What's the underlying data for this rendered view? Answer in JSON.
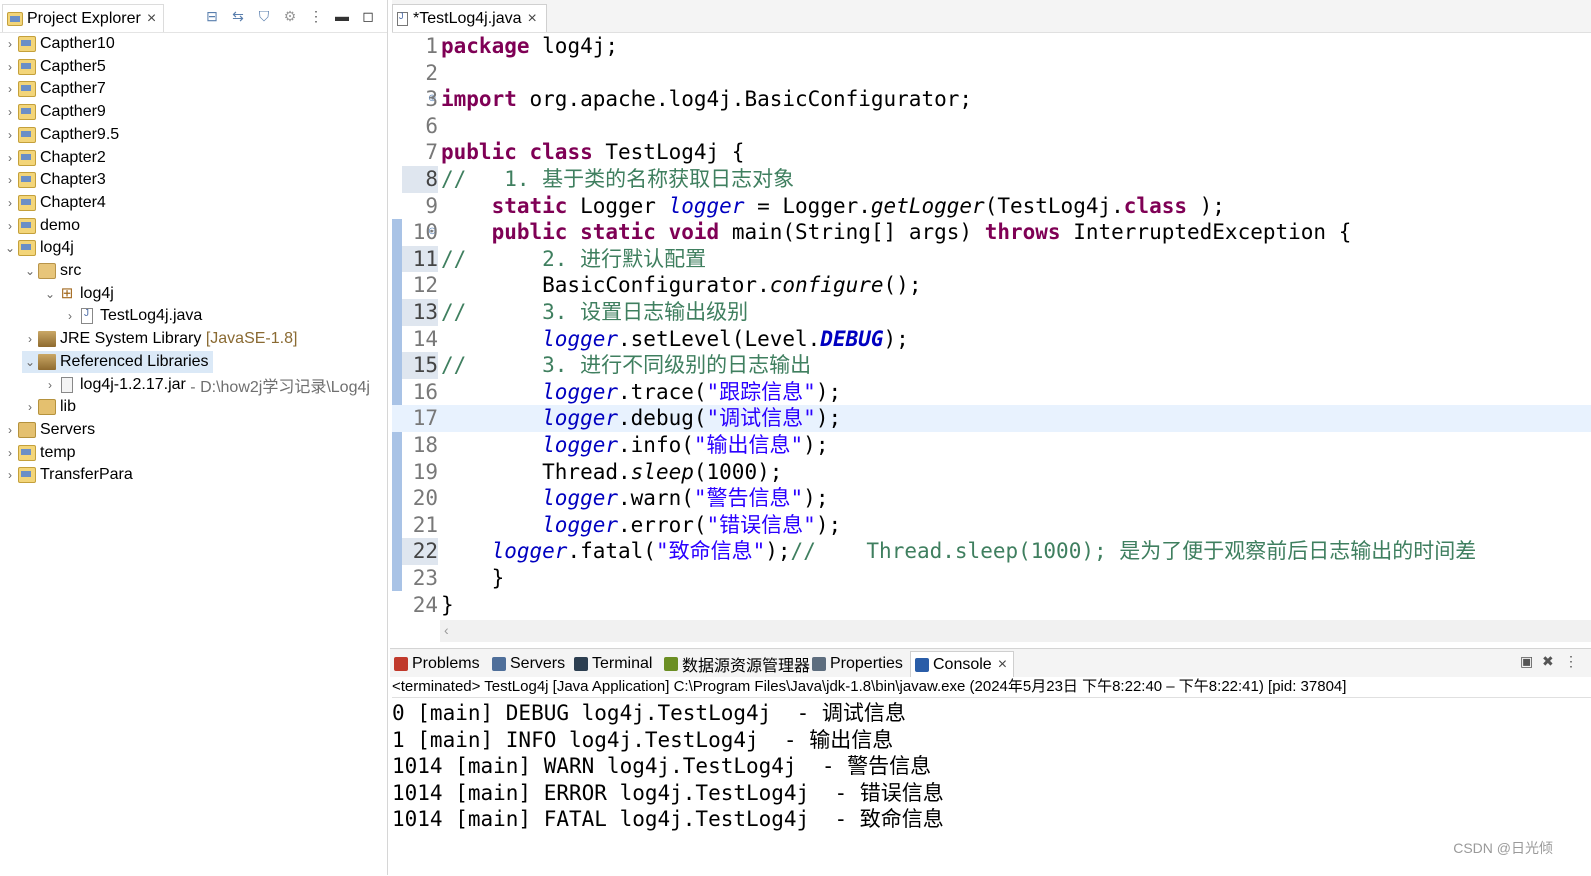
{
  "explorer": {
    "title": "Project Explorer",
    "tree": [
      {
        "label": "Capther10"
      },
      {
        "label": "Capther5"
      },
      {
        "label": "Capther7"
      },
      {
        "label": "Capther9"
      },
      {
        "label": "Capther9.5"
      },
      {
        "label": "Chapter2"
      },
      {
        "label": "Chapter3"
      },
      {
        "label": "Chapter4"
      },
      {
        "label": "demo"
      },
      {
        "label": "log4j"
      },
      {
        "label": "src"
      },
      {
        "label": "log4j"
      },
      {
        "label": "TestLog4j.java"
      },
      {
        "label": "JRE System Library",
        "suffix": "[JavaSE-1.8]"
      },
      {
        "label": "Referenced Libraries"
      },
      {
        "label": "log4j-1.2.17.jar",
        "suffix": "- D:\\how2j学习记录\\Log4j"
      },
      {
        "label": "lib"
      },
      {
        "label": "Servers"
      },
      {
        "label": "temp"
      },
      {
        "label": "TransferPara"
      }
    ]
  },
  "editor": {
    "tab_label": "*TestLog4j.java",
    "lines": [
      {
        "n": "1",
        "t": [
          [
            "kw",
            "package"
          ],
          [
            "",
            "log4j;"
          ]
        ]
      },
      {
        "n": "2",
        "t": []
      },
      {
        "n": "3",
        "t": [
          [
            "kw",
            "import"
          ],
          [
            "",
            "org.apache.log4j.BasicConfigurator;"
          ]
        ]
      },
      {
        "n": "6",
        "t": []
      },
      {
        "n": "7",
        "t": [
          [
            "kw",
            "public"
          ],
          [
            "kw",
            "class"
          ],
          [
            "",
            "TestLog4j {"
          ]
        ]
      },
      {
        "n": "8",
        "t": [
          [
            "cm",
            "//   1. 基于类的名称获取日志对象"
          ]
        ]
      },
      {
        "n": "9",
        "t": [
          [
            "",
            "    "
          ],
          [
            "kw",
            "static"
          ],
          [
            "",
            "Logger "
          ],
          [
            "fld",
            "logger"
          ],
          [
            "",
            "",
            " = Logger."
          ],
          [
            "it",
            "getLogger"
          ],
          [
            "",
            "(TestLog4j."
          ],
          [
            "kw",
            "class"
          ],
          [
            "",
            ");"
          ]
        ]
      },
      {
        "n": "10",
        "t": [
          [
            "",
            "    "
          ],
          [
            "kw",
            "public"
          ],
          [
            "kw",
            "static"
          ],
          [
            "kw",
            "void"
          ],
          [
            "",
            "main(String[] args) "
          ],
          [
            "kw",
            "throws"
          ],
          [
            "",
            "InterruptedException {"
          ]
        ]
      },
      {
        "n": "11",
        "t": [
          [
            "cm",
            "//      2. 进行默认配置"
          ]
        ]
      },
      {
        "n": "12",
        "t": [
          [
            "",
            "        BasicConfigurator."
          ],
          [
            "it",
            "configure"
          ],
          [
            "",
            "();"
          ]
        ]
      },
      {
        "n": "13",
        "t": [
          [
            "cm",
            "//      3. 设置日志输出级别"
          ]
        ]
      },
      {
        "n": "14",
        "t": [
          [
            "",
            "        "
          ],
          [
            "fld",
            "logger"
          ],
          [
            "",
            ".setLevel(Level."
          ],
          [
            "sfld",
            "DEBUG"
          ],
          [
            "",
            ");"
          ]
        ]
      },
      {
        "n": "15",
        "t": [
          [
            "cm",
            "//      3. 进行不同级别的日志输出"
          ]
        ]
      },
      {
        "n": "16",
        "t": [
          [
            "",
            "        "
          ],
          [
            "fld",
            "logger"
          ],
          [
            "",
            ".trace("
          ],
          [
            "st",
            "\"跟踪信息\""
          ],
          [
            "",
            ");"
          ]
        ]
      },
      {
        "n": "17",
        "t": [
          [
            "",
            "        "
          ],
          [
            "fld",
            "logger"
          ],
          [
            "",
            ".debug("
          ],
          [
            "st",
            "\"调试信息\""
          ],
          [
            "",
            ");"
          ]
        ]
      },
      {
        "n": "18",
        "t": [
          [
            "",
            "        "
          ],
          [
            "fld",
            "logger"
          ],
          [
            "",
            ".info("
          ],
          [
            "st",
            "\"输出信息\""
          ],
          [
            "",
            ");"
          ]
        ]
      },
      {
        "n": "19",
        "t": [
          [
            "",
            "        Thread."
          ],
          [
            "it",
            "sleep"
          ],
          [
            "",
            "(1000);"
          ]
        ]
      },
      {
        "n": "20",
        "t": [
          [
            "",
            "        "
          ],
          [
            "fld",
            "logger"
          ],
          [
            "",
            ".warn("
          ],
          [
            "st",
            "\"警告信息\""
          ],
          [
            "",
            ");"
          ]
        ]
      },
      {
        "n": "21",
        "t": [
          [
            "",
            "        "
          ],
          [
            "fld",
            "logger"
          ],
          [
            "",
            ".error("
          ],
          [
            "st",
            "\"错误信息\""
          ],
          [
            "",
            ");"
          ]
        ]
      },
      {
        "n": "22",
        "t": [
          [
            "",
            "    "
          ],
          [
            "fld",
            "logger"
          ],
          [
            "",
            ".fatal("
          ],
          [
            "st",
            "\"致命信息\""
          ],
          [
            "",
            ");"
          ],
          [
            "cm",
            "//    Thread.sleep(1000); 是为了便于观察前后日志输出的时间差"
          ]
        ]
      },
      {
        "n": "23",
        "t": [
          [
            "",
            "    }"
          ]
        ]
      },
      {
        "n": "24",
        "t": [
          [
            "",
            "}"
          ]
        ]
      }
    ]
  },
  "console": {
    "tabs": [
      {
        "label": "Problems",
        "icon": "problems-icon",
        "color": "#c0392b"
      },
      {
        "label": "Servers",
        "icon": "servers-icon",
        "color": "#4f6f9a"
      },
      {
        "label": "Terminal",
        "icon": "terminal-icon",
        "color": "#2c3e50"
      },
      {
        "label": "数据源资源管理器",
        "icon": "datasource-icon",
        "color": "#6b8e23"
      },
      {
        "label": "Properties",
        "icon": "properties-icon",
        "color": "#5d6d7e"
      },
      {
        "label": "Console",
        "icon": "console-icon",
        "color": "#2a5da8"
      }
    ],
    "status": "<terminated> TestLog4j [Java Application] C:\\Program Files\\Java\\jdk-1.8\\bin\\javaw.exe  (2024年5月23日 下午8:22:40 – 下午8:22:41) [pid: 37804]",
    "output": [
      "0 [main] DEBUG log4j.TestLog4j  - 调试信息",
      "1 [main] INFO log4j.TestLog4j  - 输出信息",
      "1014 [main] WARN log4j.TestLog4j  - 警告信息",
      "1014 [main] ERROR log4j.TestLog4j  - 错误信息",
      "1014 [main] FATAL log4j.TestLog4j  - 致命信息"
    ]
  },
  "watermark": "CSDN @日光倾"
}
